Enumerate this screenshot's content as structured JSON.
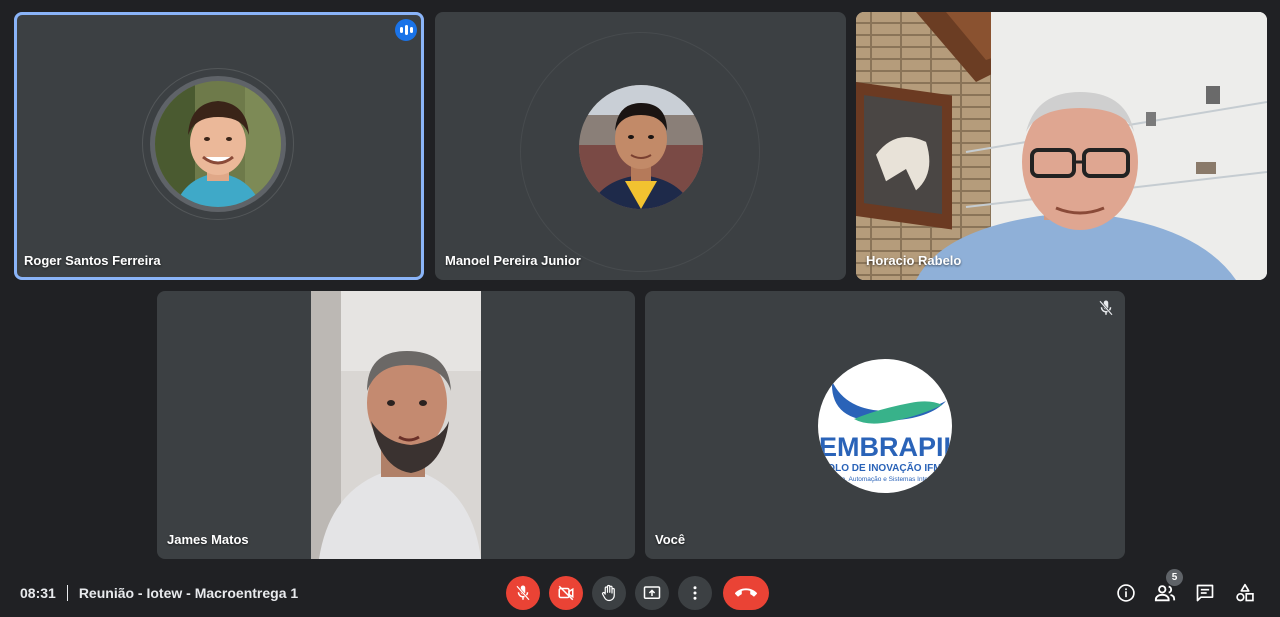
{
  "participants": [
    {
      "name": "Roger Santos Ferreira",
      "speaking": true
    },
    {
      "name": "Manoel Pereira Junior"
    },
    {
      "name": "Horacio Rabelo"
    },
    {
      "name": "James Matos"
    },
    {
      "name": "Você",
      "muted": true
    }
  ],
  "self_logo": {
    "brand": "EMBRAPII",
    "line1": "POLO DE INOVAÇÃO IFMG",
    "line2": "Robótica, Automação e Sistemas Inteligentes"
  },
  "meeting": {
    "time": "08:31",
    "title": "Reunião - Iotew - Macroentrega 1"
  },
  "controls": [
    "mic-off",
    "camera-off",
    "raise-hand",
    "present",
    "more-options",
    "end-call"
  ],
  "side_controls": {
    "participants_count": "5"
  },
  "colors": {
    "background": "#202124",
    "tile": "#3c4043",
    "accent": "#8ab4f8",
    "danger": "#ea4335"
  }
}
